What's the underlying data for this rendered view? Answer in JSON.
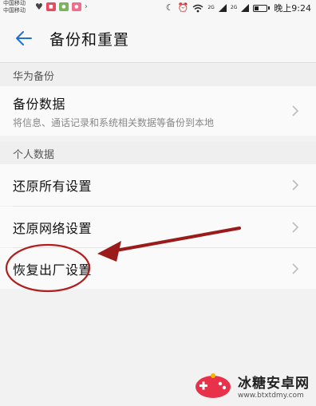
{
  "status_bar": {
    "carrier_1": "中国移动",
    "carrier_2": "中国移动",
    "time": "晚上9:24",
    "signal_label_1": "2G",
    "signal_label_2": "2G",
    "icons": [
      "heart-icon",
      "app-icon",
      "weibo-icon",
      "arrow-icon",
      "moon-icon",
      "alarm-icon",
      "wifi-icon",
      "signal-icon",
      "battery-icon"
    ]
  },
  "header": {
    "title": "备份和重置",
    "back_icon": "arrow-left-icon"
  },
  "sections": [
    {
      "title": "华为备份",
      "items": [
        {
          "label": "备份数据",
          "subtitle": "将信息、通话记录和系统相关数据等备份到本地"
        }
      ]
    },
    {
      "title": "个人数据",
      "items": [
        {
          "label": "还原所有设置"
        },
        {
          "label": "还原网络设置"
        },
        {
          "label": "恢复出厂设置"
        }
      ]
    }
  ],
  "colors": {
    "accent": "#1e6fd9",
    "annotation": "#b01e1e"
  },
  "watermark": {
    "name": "冰糖安卓网",
    "url": "www.btxtdmy.com"
  }
}
